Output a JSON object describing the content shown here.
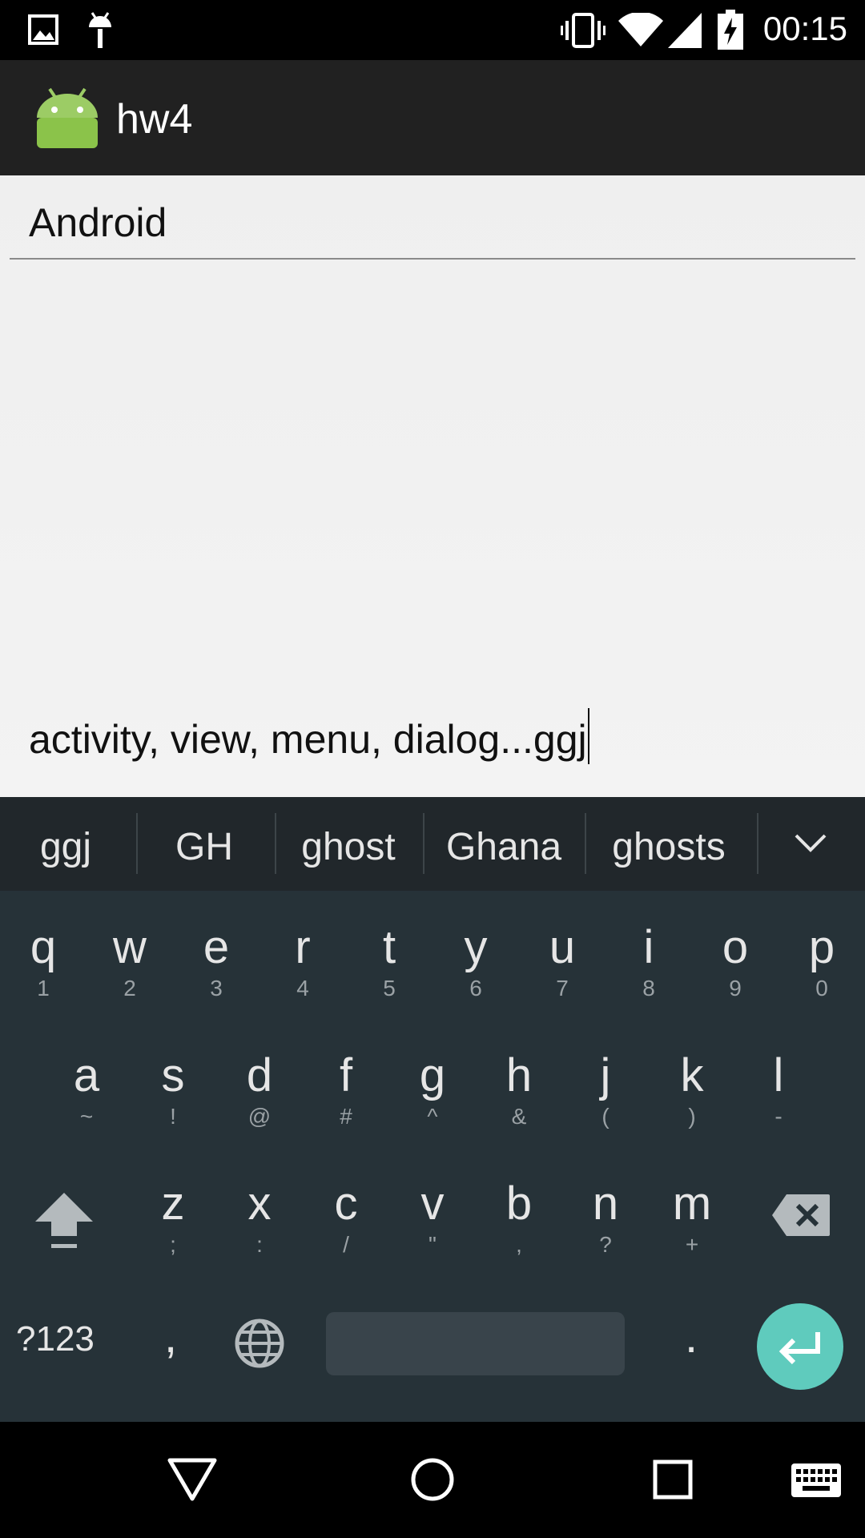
{
  "status_bar": {
    "time": "00:15"
  },
  "app_bar": {
    "title": "hw4"
  },
  "form": {
    "field1_value": "Android",
    "field2_value": "activity, view, menu, dialog...",
    "field2_composing": "ggj"
  },
  "keyboard": {
    "suggestions": [
      "ggj",
      "GH",
      "ghost",
      "Ghana",
      "ghosts"
    ],
    "row1": [
      {
        "k": "q",
        "a": "1"
      },
      {
        "k": "w",
        "a": "2"
      },
      {
        "k": "e",
        "a": "3"
      },
      {
        "k": "r",
        "a": "4"
      },
      {
        "k": "t",
        "a": "5"
      },
      {
        "k": "y",
        "a": "6"
      },
      {
        "k": "u",
        "a": "7"
      },
      {
        "k": "i",
        "a": "8"
      },
      {
        "k": "o",
        "a": "9"
      },
      {
        "k": "p",
        "a": "0"
      }
    ],
    "row2": [
      {
        "k": "a",
        "a": "~"
      },
      {
        "k": "s",
        "a": "!"
      },
      {
        "k": "d",
        "a": "@"
      },
      {
        "k": "f",
        "a": "#"
      },
      {
        "k": "g",
        "a": "^"
      },
      {
        "k": "h",
        "a": "&"
      },
      {
        "k": "j",
        "a": "("
      },
      {
        "k": "k",
        "a": ")"
      },
      {
        "k": "l",
        "a": "-"
      }
    ],
    "row3": [
      {
        "k": "z",
        "a": ";"
      },
      {
        "k": "x",
        "a": ":"
      },
      {
        "k": "c",
        "a": "/"
      },
      {
        "k": "v",
        "a": "\""
      },
      {
        "k": "b",
        "a": ","
      },
      {
        "k": "n",
        "a": "?"
      },
      {
        "k": "m",
        "a": "+"
      }
    ],
    "symbols_key": "?123",
    "comma_key": ",",
    "period_key": "."
  }
}
